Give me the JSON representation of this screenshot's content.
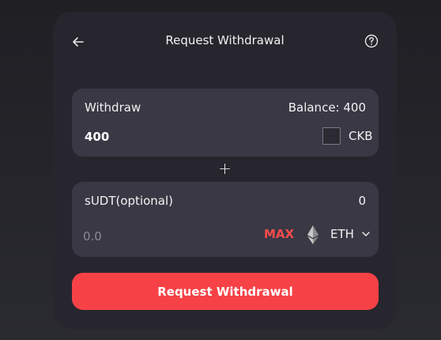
{
  "header": {
    "title": "Request Withdrawal",
    "back_icon": "arrow-left-icon",
    "help_icon": "question-circle-icon"
  },
  "withdraw": {
    "label": "Withdraw",
    "balance": "Balance: 400",
    "amount": "400",
    "token": "CKB"
  },
  "plus_symbol": "+",
  "sudt": {
    "label": "sUDT(optional)",
    "balance": "0",
    "placeholder": "0.0",
    "max_label": "MAX",
    "token": "ETH",
    "token_icon": "ethereum-icon"
  },
  "submit": {
    "label": "Request Withdrawal"
  },
  "colors": {
    "background": "#222227",
    "card": "#27262e",
    "panel": "#3a3844",
    "accent": "#f64246",
    "max": "#ff4b4b"
  }
}
